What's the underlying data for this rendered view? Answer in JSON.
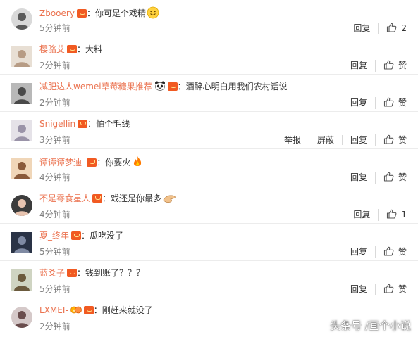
{
  "colors": {
    "username": "#eb7350",
    "time": "#808080",
    "text": "#333333",
    "divider": "#ececec"
  },
  "comments": [
    {
      "user": "Zbooery",
      "text": "你可是个戏精",
      "emoji": "smile-emoji",
      "time": "5分钟前",
      "reply": "回复",
      "like_count": "2",
      "avatar_colors": [
        "#d9d9d9",
        "#5a5a5a"
      ]
    },
    {
      "user": "樱骆艾",
      "text": "大料",
      "time": "2分钟前",
      "reply": "回复",
      "like_label": "赞",
      "avatar_colors": [
        "#e8dfd4",
        "#b79c85"
      ]
    },
    {
      "user": "减肥达人wemei草莓糖果推荐",
      "badge": "panda-icon",
      "text": "酒醉心明白用我们农村话说",
      "time": "2分钟前",
      "reply": "回复",
      "like_label": "赞",
      "avatar_colors": [
        "#b8b8b8",
        "#4a4a4a"
      ]
    },
    {
      "user": "Snigellin",
      "text": "怕个毛线",
      "time": "3分钟前",
      "report": "举报",
      "block": "屏蔽",
      "reply": "回复",
      "like_label": "赞",
      "avatar_colors": [
        "#e5e2e8",
        "#9a93a8"
      ]
    },
    {
      "user": "谭谭谭梦迪-",
      "text": "你要火",
      "emoji": "fire-emoji",
      "time": "4分钟前",
      "reply": "回复",
      "like_label": "赞",
      "avatar_colors": [
        "#f0d6b8",
        "#8a5a3a"
      ]
    },
    {
      "user": "不是零食星人",
      "text": "戏还是你最多",
      "emoji": "hand-emoji",
      "time": "4分钟前",
      "reply": "回复",
      "like_count": "1",
      "avatar_colors": [
        "#3c3c3c",
        "#e8c4b0"
      ]
    },
    {
      "user": "夏_终年",
      "text": "瓜吃没了",
      "time": "5分钟前",
      "reply": "回复",
      "like_label": "赞",
      "avatar_colors": [
        "#2a3346",
        "#7f8aa3"
      ]
    },
    {
      "user": "蓝爻子",
      "text": "钱到账了？？？",
      "time": "5分钟前",
      "reply": "回复",
      "like_label": "赞",
      "avatar_colors": [
        "#cfd4c2",
        "#6b5a3d"
      ]
    },
    {
      "user": "LXMEI-",
      "badge": "medal-icon",
      "text": "刚赶来就没了",
      "time": "2分钟前",
      "avatar_colors": [
        "#d5c9c9",
        "#6a4d4d"
      ]
    }
  ],
  "separator": "：",
  "watermark": "头条号 /画个小说"
}
